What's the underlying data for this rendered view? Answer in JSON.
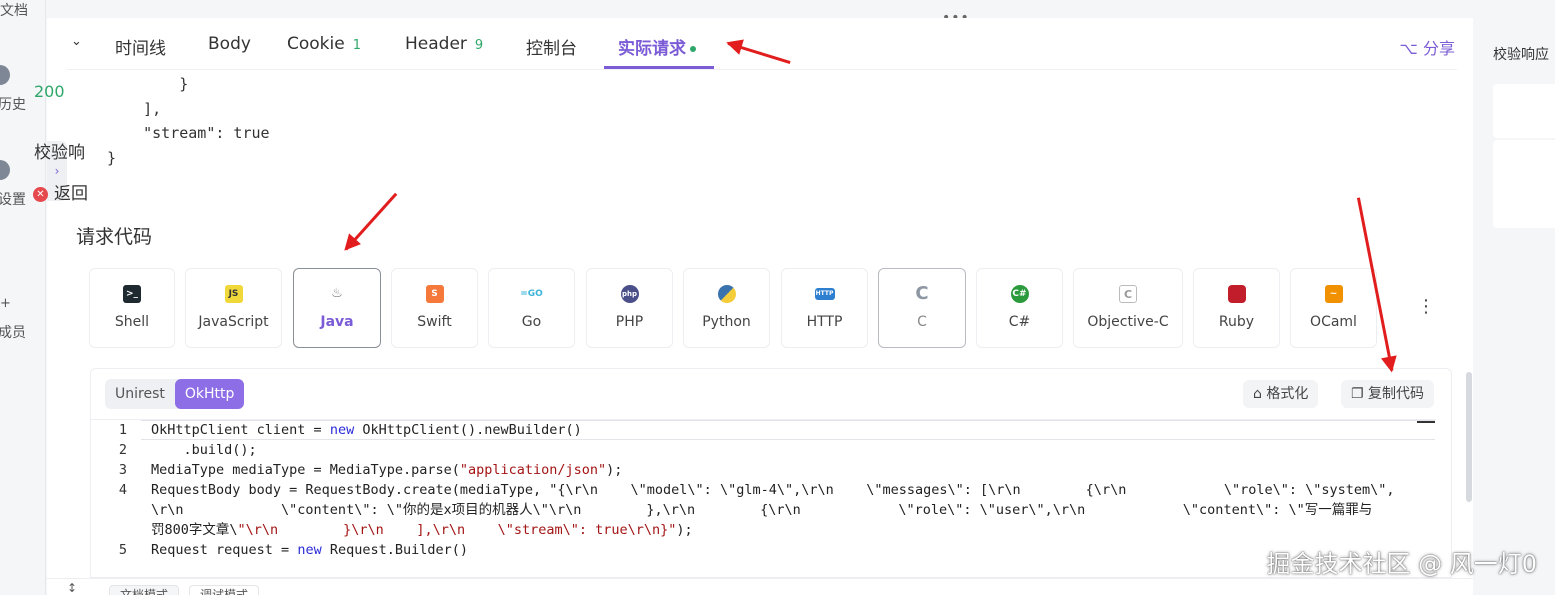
{
  "left_sidebar": {
    "items": [
      {
        "label": "文档"
      },
      {
        "label": "历史"
      },
      {
        "label": "设置"
      },
      {
        "label": "成员"
      }
    ]
  },
  "tabs": {
    "items": [
      {
        "label": "时间线"
      },
      {
        "label": "Body"
      },
      {
        "label": "Cookie",
        "count": "1"
      },
      {
        "label": "Header",
        "count": "9"
      },
      {
        "label": "控制台"
      },
      {
        "label": "实际请求",
        "active": true
      }
    ],
    "share_label": "分享"
  },
  "json_body": "        }\n    ],\n    \"stream\": true\n}",
  "section_title": "请求代码",
  "languages": [
    {
      "name": "Shell",
      "icon": "terminal-icon"
    },
    {
      "name": "JavaScript",
      "icon": "js-icon"
    },
    {
      "name": "Java",
      "icon": "java-icon",
      "selected": true
    },
    {
      "name": "Swift",
      "icon": "swift-icon"
    },
    {
      "name": "Go",
      "icon": "go-icon"
    },
    {
      "name": "PHP",
      "icon": "php-icon"
    },
    {
      "name": "Python",
      "icon": "python-icon"
    },
    {
      "name": "HTTP",
      "icon": "http-icon"
    },
    {
      "name": "C",
      "icon": "c-icon"
    },
    {
      "name": "C#",
      "icon": "csharp-icon"
    },
    {
      "name": "Objective-C",
      "icon": "objc-icon"
    },
    {
      "name": "Ruby",
      "icon": "ruby-icon"
    },
    {
      "name": "OCaml",
      "icon": "ocaml-icon"
    }
  ],
  "code_panel": {
    "libraries": [
      {
        "label": "Unirest"
      },
      {
        "label": "OkHttp",
        "active": true
      }
    ],
    "format_label": "格式化",
    "copy_label": "复制代码",
    "lines": [
      {
        "num": "1",
        "text": "OkHttpClient client = new OkHttpClient().newBuilder()"
      },
      {
        "num": "2",
        "text": "    .build();"
      },
      {
        "num": "3",
        "text": "MediaType mediaType = MediaType.parse(\"application/json\");"
      },
      {
        "num": "4",
        "text": "RequestBody body = RequestBody.create(mediaType, \"{\\r\\n    \\\"model\\\": \\\"glm-4\\\",\\r\\n    \\\"messages\\\": [\\r\\n        {\\r\\n            \\\"role\\\": \\\"system\\\","
      },
      {
        "num": "",
        "text": "\\r\\n            \\\"content\\\": \\\"你的是x项目的机器人\\\"\\r\\n        },\\r\\n        {\\r\\n            \\\"role\\\": \\\"user\\\",\\r\\n            \\\"content\\\": \\\"写一篇罪与"
      },
      {
        "num": "",
        "text": "罚800字文章\\\"\\r\\n        }\\r\\n    ],\\r\\n    \\\"stream\\\": true\\r\\n}\");"
      },
      {
        "num": "5",
        "text": "Request request = new Request.Builder()"
      }
    ]
  },
  "right_panel": {
    "title": "校验响应",
    "status_code": "200",
    "check_label": "校验响",
    "return_label": "返回"
  },
  "bottom_bar": {
    "doc_mode": "文档模式",
    "debug_mode": "调试模式"
  },
  "watermark": "掘金技术社区 @ 风一灯0",
  "colors": {
    "accent": "#7b5cd6",
    "success": "#2fa66a",
    "error": "#e5484d",
    "annotation_arrow": "#e11d1d"
  }
}
